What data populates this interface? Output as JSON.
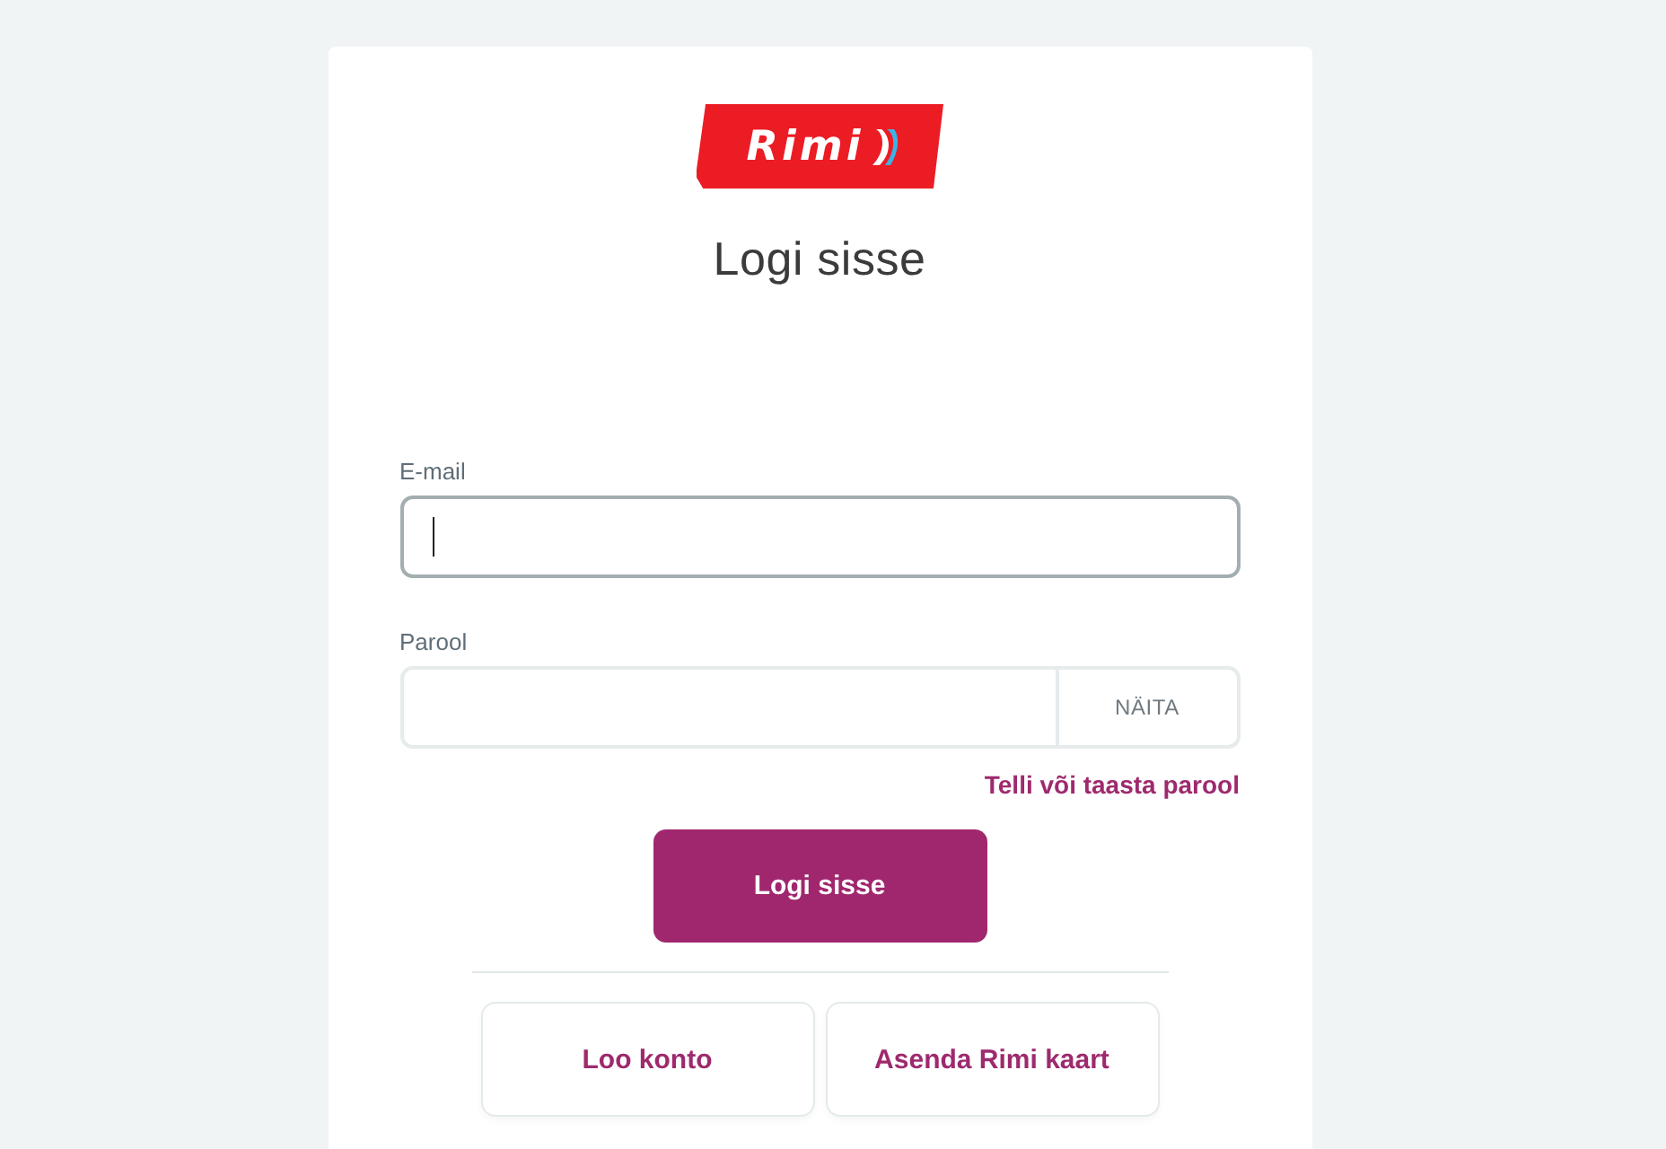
{
  "logo": {
    "text": "Rimi"
  },
  "title": "Logi sisse",
  "fields": [
    {
      "kind": "email",
      "label": "E-mail",
      "focused": true
    },
    {
      "kind": "password",
      "label": "Parool",
      "focused": false,
      "toggle": "NÄITA"
    }
  ],
  "forgot_link": "Telli või taasta parool",
  "submit": "Logi sisse",
  "secondary_buttons": [
    "Loo konto",
    "Asenda Rimi kaart"
  ]
}
